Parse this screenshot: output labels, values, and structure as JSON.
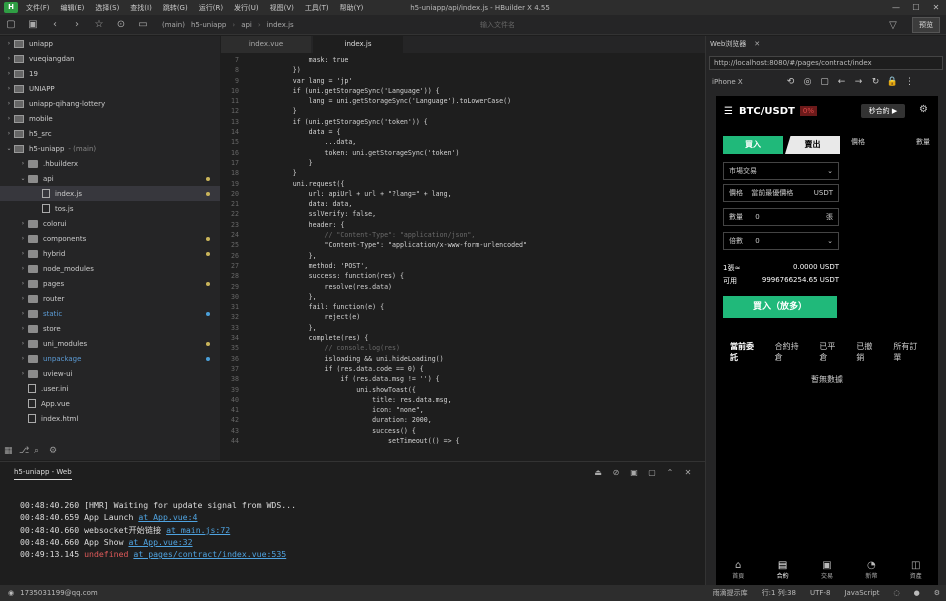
{
  "window": {
    "title": "h5-uniapp/api/index.js - HBuilder X 4.55",
    "menu": [
      "文件(F)",
      "编辑(E)",
      "选择(S)",
      "查找(I)",
      "跳转(G)",
      "运行(R)",
      "发行(U)",
      "视图(V)",
      "工具(T)",
      "帮助(Y)"
    ],
    "logo": "H"
  },
  "toolbar": {
    "breadcrumb": [
      "(main)",
      "h5-uniapp",
      "api",
      "index.js"
    ],
    "search_placeholder": "输入文件名",
    "preview_label": "预览"
  },
  "sidebar": {
    "items": [
      {
        "label": "uniapp",
        "indent": 0,
        "arrow": "›",
        "icon": "proj"
      },
      {
        "label": "vueqiangdan",
        "indent": 0,
        "arrow": "›",
        "icon": "proj"
      },
      {
        "label": "19",
        "indent": 0,
        "arrow": "›",
        "icon": "proj"
      },
      {
        "label": "UNIAPP",
        "indent": 0,
        "arrow": "›",
        "icon": "proj"
      },
      {
        "label": "uniapp-qihang-lottery",
        "indent": 0,
        "arrow": "›",
        "icon": "proj"
      },
      {
        "label": "mobile",
        "indent": 0,
        "arrow": "›",
        "icon": "proj"
      },
      {
        "label": "h5_src",
        "indent": 0,
        "arrow": "›",
        "icon": "proj"
      },
      {
        "label": "h5-uniapp",
        "extra": "- (main)",
        "indent": 0,
        "arrow": "⌄",
        "icon": "proj"
      },
      {
        "label": ".hbuilderx",
        "indent": 1,
        "arrow": "›",
        "icon": "folder"
      },
      {
        "label": "api",
        "indent": 1,
        "arrow": "⌄",
        "icon": "folder",
        "dot": "yellow"
      },
      {
        "label": "index.js",
        "indent": 2,
        "arrow": "",
        "icon": "file",
        "dot": "yellow",
        "selected": true
      },
      {
        "label": "tos.js",
        "indent": 2,
        "arrow": "",
        "icon": "file"
      },
      {
        "label": "colorui",
        "indent": 1,
        "arrow": "›",
        "icon": "folder"
      },
      {
        "label": "components",
        "indent": 1,
        "arrow": "›",
        "icon": "folder",
        "dot": "yellow"
      },
      {
        "label": "hybrid",
        "indent": 1,
        "arrow": "›",
        "icon": "folder",
        "dot": "yellow"
      },
      {
        "label": "node_modules",
        "indent": 1,
        "arrow": "›",
        "icon": "folder"
      },
      {
        "label": "pages",
        "indent": 1,
        "arrow": "›",
        "icon": "folder",
        "dot": "yellow"
      },
      {
        "label": "router",
        "indent": 1,
        "arrow": "›",
        "icon": "folder"
      },
      {
        "label": "static",
        "indent": 1,
        "arrow": "›",
        "icon": "folder",
        "dot": "blue"
      },
      {
        "label": "store",
        "indent": 1,
        "arrow": "›",
        "icon": "folder"
      },
      {
        "label": "uni_modules",
        "indent": 1,
        "arrow": "›",
        "icon": "folder",
        "dot": "yellow"
      },
      {
        "label": "unpackage",
        "indent": 1,
        "arrow": "›",
        "icon": "folder",
        "dot": "blue"
      },
      {
        "label": "uview-ui",
        "indent": 1,
        "arrow": "›",
        "icon": "folder"
      },
      {
        "label": ".user.ini",
        "indent": 1,
        "arrow": "",
        "icon": "file"
      },
      {
        "label": "App.vue",
        "indent": 1,
        "arrow": "",
        "icon": "file"
      },
      {
        "label": "index.html",
        "indent": 1,
        "arrow": "",
        "icon": "file"
      }
    ]
  },
  "editor": {
    "tabs": [
      "index.vue",
      "index.js"
    ],
    "active_tab": 1,
    "lines": [
      {
        "n": "7",
        "t": "            mask: true"
      },
      {
        "n": "8",
        "t": "        })"
      },
      {
        "n": "9",
        "t": "        var lang = 'jp'"
      },
      {
        "n": "10",
        "t": "        if (uni.getStorageSync('Language')) {"
      },
      {
        "n": "11",
        "t": "            lang = uni.getStorageSync('Language').toLowerCase()"
      },
      {
        "n": "12",
        "t": "        }"
      },
      {
        "n": "13",
        "t": "        if (uni.getStorageSync('token')) {"
      },
      {
        "n": "14",
        "t": "            data = {"
      },
      {
        "n": "15",
        "t": "                ...data,"
      },
      {
        "n": "16",
        "t": "                token: uni.getStorageSync('token')"
      },
      {
        "n": "17",
        "t": "            }"
      },
      {
        "n": "18",
        "t": "        }"
      },
      {
        "n": "19",
        "t": "        uni.request({"
      },
      {
        "n": "20",
        "t": "            url: apiUrl + url + \"?lang=\" + lang,"
      },
      {
        "n": "21",
        "t": "            data: data,"
      },
      {
        "n": "22",
        "t": "            sslVerify: false,"
      },
      {
        "n": "23",
        "t": "            header: {"
      },
      {
        "n": "24",
        "t": "                // \"Content-Type\": \"application/json\","
      },
      {
        "n": "25",
        "t": "                \"Content-Type\": \"application/x-www-form-urlencoded\""
      },
      {
        "n": "26",
        "t": "            },"
      },
      {
        "n": "27",
        "t": "            method: 'POST',"
      },
      {
        "n": "28",
        "t": "            success: function(res) {"
      },
      {
        "n": "29",
        "t": "                resolve(res.data)"
      },
      {
        "n": "30",
        "t": "            },"
      },
      {
        "n": "31",
        "t": "            fail: function(e) {"
      },
      {
        "n": "32",
        "t": "                reject(e)"
      },
      {
        "n": "33",
        "t": "            },"
      },
      {
        "n": "34",
        "t": "            complete(res) {"
      },
      {
        "n": "35",
        "t": "                // console.log(res)"
      },
      {
        "n": "36",
        "t": "                isloading && uni.hideLoading()"
      },
      {
        "n": "37",
        "t": "                if (res.data.code == 0) {"
      },
      {
        "n": "38",
        "t": "                    if (res.data.msg != '') {"
      },
      {
        "n": "39",
        "t": "                        uni.showToast({"
      },
      {
        "n": "40",
        "t": "                            title: res.data.msg,"
      },
      {
        "n": "41",
        "t": "                            icon: \"none\","
      },
      {
        "n": "42",
        "t": "                            duration: 2000,"
      },
      {
        "n": "43",
        "t": "                            success() {"
      },
      {
        "n": "44",
        "t": "                                setTimeout(() => {"
      }
    ]
  },
  "console": {
    "tab": "h5-uniapp - Web",
    "lines": [
      {
        "pre": "00:48:40.260 [HMR] Waiting for update signal from WDS...",
        "link": "",
        "err": ""
      },
      {
        "pre": "00:48:40.659 App Launch ",
        "link": "at App.vue:4",
        "err": ""
      },
      {
        "pre": "00:48:40.660 websocket开始链接 ",
        "link": "at main.js:72",
        "err": ""
      },
      {
        "pre": "00:48:40.660 App Show ",
        "link": "at App.vue:32",
        "err": ""
      },
      {
        "pre": "00:49:13.145 ",
        "err": "undefined",
        "link": "at pages/contract/index.vue:535"
      }
    ]
  },
  "browser": {
    "tab": "Web浏览器",
    "url": "http://localhost:8080/#/pages/contract/index",
    "device": "iPhone X",
    "app": {
      "pair": "BTC/USDT",
      "change": "0%",
      "seconds_btn": "秒合約 ▶",
      "buy": "買入",
      "sell": "賣出",
      "price_label": "價格",
      "qty_label": "數量",
      "order_type": "市場交易",
      "price_field_label": "價格",
      "price_field_value": "當前最優價格",
      "price_unit": "USDT",
      "qty_field_label": "數量",
      "qty_value": "0",
      "qty_unit": "張",
      "multiplier_label": "倍數",
      "multiplier_value": "0",
      "margin_label": "1張≈",
      "margin_value": "0.0000 USDT",
      "avail_label": "可用",
      "avail_value": "9996766254.65 USDT",
      "buy_long": "買入（放多）",
      "order_tabs": [
        "當前委託",
        "合約持倉",
        "已平倉",
        "已撤銷",
        "所有訂單"
      ],
      "empty": "暫無數據",
      "nav": [
        "首頁",
        "合約",
        "交易",
        "新幣",
        "資產"
      ]
    }
  },
  "statusbar": {
    "user": "1735031199@qq.com",
    "theme": "雨滴提示库",
    "position": "行:1  列:38",
    "encoding": "UTF-8",
    "language": "JavaScript"
  }
}
